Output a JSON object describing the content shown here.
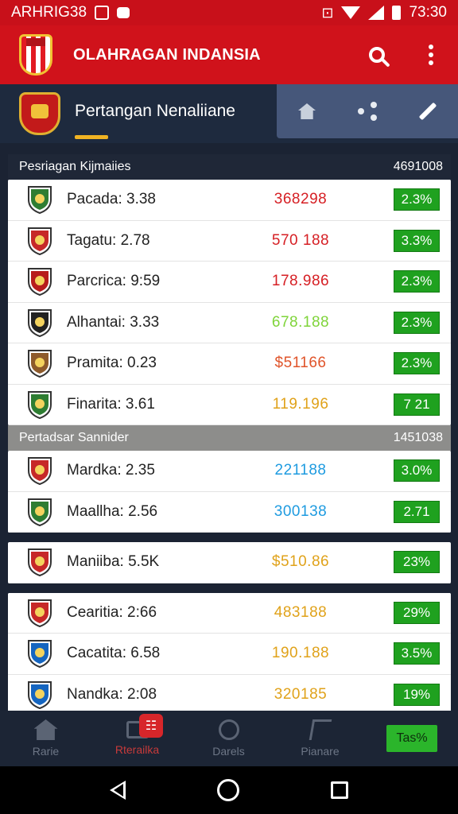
{
  "status_bar": {
    "left_text": "ARHRIG38",
    "time": "73:30"
  },
  "app_bar": {
    "title": "OLAHRAGAN INDANSIA"
  },
  "sub_header": {
    "title": "Pertangan Nenaliiane"
  },
  "sections": [
    {
      "title": "Pesriagan Kijmaiies",
      "total": "4691008",
      "rows": [
        {
          "name": "Pacada: 3.38",
          "value": "368298",
          "value_color": "#d61f24",
          "pct": "2.3%",
          "icon_color": "#2e7d32"
        },
        {
          "name": "Tagatu: 2.78",
          "value": "570 188",
          "value_color": "#d61f24",
          "pct": "3.3%",
          "icon_color": "#c62828"
        },
        {
          "name": "Parcrica: 9:59",
          "value": "178.986",
          "value_color": "#d61f24",
          "pct": "2.3%",
          "icon_color": "#b71c1c"
        },
        {
          "name": "Alhantai: 3.33",
          "value": "678.188",
          "value_color": "#7fd43a",
          "pct": "2.3%",
          "icon_color": "#222222"
        },
        {
          "name": "Pramita: 0.23",
          "value": "$51166",
          "value_color": "#e0542a",
          "pct": "2.3%",
          "icon_color": "#8d5a2b"
        },
        {
          "name": "Finarita: 3.61",
          "value": "119.196",
          "value_color": "#e0a21a",
          "pct": "7 21",
          "icon_color": "#2e7d32"
        }
      ]
    },
    {
      "title": "Pertadsar Sannider",
      "total": "1451038",
      "rows": [
        {
          "name": "Mardka: 2.35",
          "value": "221188",
          "value_color": "#1e9be0",
          "pct": "3.0%",
          "icon_color": "#c62828"
        },
        {
          "name": "Maallha: 2.56",
          "value": "300138",
          "value_color": "#1e9be0",
          "pct": "2.71",
          "icon_color": "#2e7d32"
        }
      ]
    }
  ],
  "single_card": [
    {
      "name": "Maniiba: 5.5K",
      "value": "$510.86",
      "value_color": "#e0a21a",
      "pct": "23%",
      "icon_color": "#c62828"
    }
  ],
  "last_card": [
    {
      "name": "Cearitia: 2:66",
      "value": "483188",
      "value_color": "#e0a21a",
      "pct": "29%",
      "icon_color": "#c62828"
    },
    {
      "name": "Cacatita: 6.58",
      "value": "190.188",
      "value_color": "#e0a21a",
      "pct": "3.5%",
      "icon_color": "#1565c0"
    },
    {
      "name": "Nandka: 2:08",
      "value": "320185",
      "value_color": "#e0a21a",
      "pct": "19%",
      "icon_color": "#1565c0"
    }
  ],
  "bottom_nav": {
    "items": [
      {
        "label": "Rarie",
        "active": false
      },
      {
        "label": "Rterailka",
        "active": true,
        "badge": "☷"
      },
      {
        "label": "Darels",
        "active": false
      },
      {
        "label": "Pianare",
        "active": false
      }
    ],
    "chip": "Tas%"
  }
}
